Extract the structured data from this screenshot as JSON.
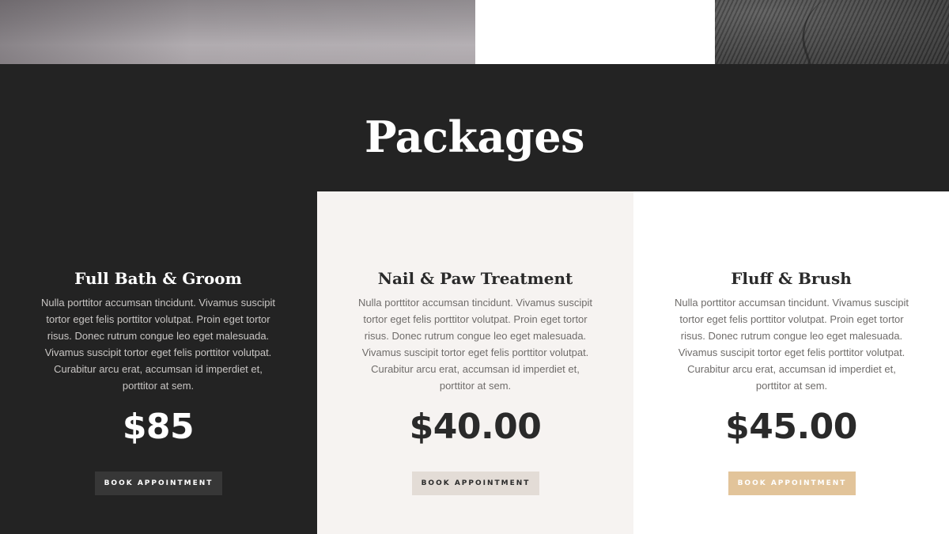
{
  "section": {
    "title": "Packages"
  },
  "packages": [
    {
      "title": "Full Bath & Groom",
      "description": "Nulla porttitor accumsan tincidunt. Vivamus suscipit tortor eget felis porttitor volutpat. Proin eget tortor risus. Donec rutrum congue leo eget malesuada. Vivamus suscipit tortor eget felis porttitor volutpat. Curabitur arcu erat, accumsan id imperdiet et, porttitor at sem.",
      "price": "$85",
      "button_label": "BOOK APPOINTMENT"
    },
    {
      "title": "Nail & Paw Treatment",
      "description": "Nulla porttitor accumsan tincidunt. Vivamus suscipit tortor eget felis porttitor volutpat. Proin eget tortor risus. Donec rutrum congue leo eget malesuada. Vivamus suscipit tortor eget felis porttitor volutpat. Curabitur arcu erat, accumsan id imperdiet et, porttitor at sem.",
      "price": "$40.00",
      "button_label": "BOOK APPOINTMENT"
    },
    {
      "title": "Fluff & Brush",
      "description": "Nulla porttitor accumsan tincidunt. Vivamus suscipit tortor eget felis porttitor volutpat. Proin eget tortor risus. Donec rutrum congue leo eget malesuada. Vivamus suscipit tortor eget felis porttitor volutpat. Curabitur arcu erat, accumsan id imperdiet et, porttitor at sem.",
      "price": "$45.00",
      "button_label": "BOOK APPOINTMENT"
    }
  ],
  "colors": {
    "dark_background": "#232323",
    "light_card_background": "#f6f3f1",
    "white_card_background": "#ffffff",
    "accent_tan": "#e2c49a",
    "button_beige": "#e3dcd6",
    "button_dark": "#373737"
  }
}
